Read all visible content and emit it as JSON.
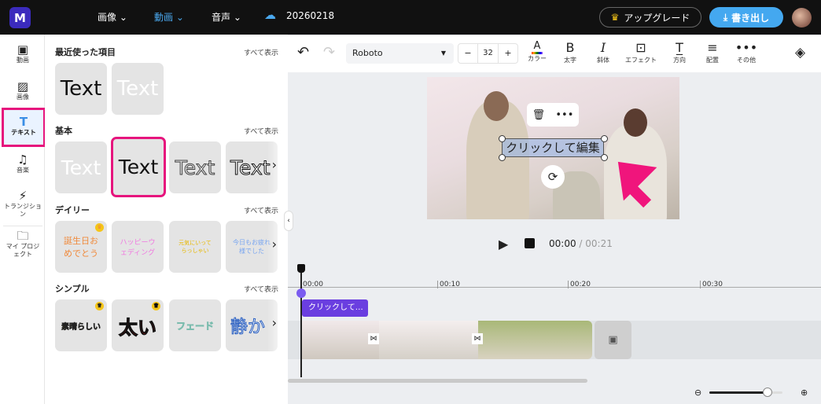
{
  "header": {
    "logo": "M",
    "nav": [
      {
        "label": "画像",
        "active": false
      },
      {
        "label": "動画",
        "active": true
      },
      {
        "label": "音声",
        "active": false
      }
    ],
    "project_name": "20260218",
    "upgrade_label": "アップグレード",
    "export_label": "書き出し",
    "accent": "#44a8f0"
  },
  "rail": [
    {
      "label": "動画",
      "icon": "film-icon"
    },
    {
      "label": "画像",
      "icon": "image-icon"
    },
    {
      "label": "テキスト",
      "icon": "text-icon",
      "selected": true
    },
    {
      "label": "音楽",
      "icon": "music-icon"
    },
    {
      "label": "トランジション",
      "icon": "transition-icon"
    },
    {
      "label": "マイ プロジェクト",
      "icon": "folder-icon"
    }
  ],
  "panel": {
    "show_all": "すべて表示",
    "sections": [
      {
        "title": "最近使った項目",
        "tiles": [
          "Text",
          "Text"
        ]
      },
      {
        "title": "基本",
        "tiles": [
          "Text",
          "Text",
          "Text",
          "Text"
        ]
      },
      {
        "title": "デイリー",
        "tiles": [
          "誕生日おめでとう",
          "ハッピーウェディング",
          "元気にいってらっしゃい",
          "今日もお疲れ様でした"
        ]
      },
      {
        "title": "シンプル",
        "tiles": [
          "素晴らしい",
          "太い",
          "フェード",
          "静か"
        ]
      }
    ]
  },
  "toolbar": {
    "font": "Roboto",
    "font_size": "32",
    "minus": "−",
    "plus": "+",
    "tools": [
      "カラー",
      "太字",
      "斜体",
      "エフェクト",
      "方向",
      "配置",
      "その他"
    ]
  },
  "canvas": {
    "text": "クリックして編集"
  },
  "player": {
    "current": "00:00",
    "total": "/ 00:21"
  },
  "timeline": {
    "ticks": [
      "00:00",
      "00:10",
      "00:20",
      "00:30"
    ],
    "text_clip": "クリックして…",
    "zoom_fraction": 0.8
  }
}
